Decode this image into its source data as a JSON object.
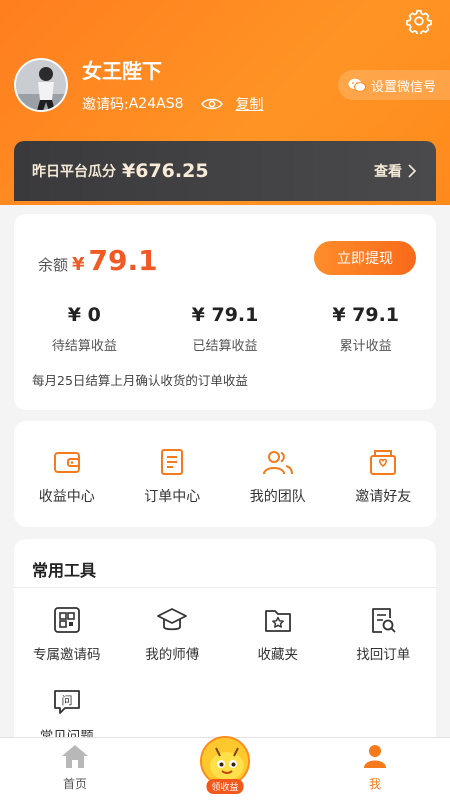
{
  "header": {
    "username": "女王陛下",
    "invite_label": "邀请码:",
    "invite_code": "A24AS8",
    "copy_label": "复制",
    "wechat_button": "设置微信号"
  },
  "platform": {
    "label": "昨日平台瓜分",
    "amount": "¥676.25",
    "view_label": "查看"
  },
  "balance": {
    "label": "余额",
    "currency": "¥",
    "value": "79.1",
    "withdraw_label": "立即提现",
    "stats": [
      {
        "value": "¥ 0",
        "label": "待结算收益"
      },
      {
        "value": "¥ 79.1",
        "label": "已结算收益"
      },
      {
        "value": "¥ 79.1",
        "label": "累计收益"
      }
    ],
    "note": "每月25日结算上月确认收货的订单收益"
  },
  "menu": [
    {
      "label": "收益中心",
      "icon": "wallet-icon"
    },
    {
      "label": "订单中心",
      "icon": "order-icon"
    },
    {
      "label": "我的团队",
      "icon": "team-icon"
    },
    {
      "label": "邀请好友",
      "icon": "invite-envelope-icon"
    }
  ],
  "tools": {
    "title": "常用工具",
    "items": [
      {
        "label": "专属邀请码",
        "icon": "qr-code-icon"
      },
      {
        "label": "我的师傅",
        "icon": "graduation-cap-icon"
      },
      {
        "label": "收藏夹",
        "icon": "folder-star-icon"
      },
      {
        "label": "找回订单",
        "icon": "order-search-icon"
      },
      {
        "label": "常见问题",
        "icon": "question-chat-icon"
      }
    ]
  },
  "tabbar": {
    "home_label": "首页",
    "center_label": "领收益",
    "me_label": "我"
  },
  "colors": {
    "brand_orange": "#ff8a1c",
    "price_red": "#f15a24",
    "active_tab": "#f47a1c",
    "dark_bar": "#3a3a3c"
  }
}
